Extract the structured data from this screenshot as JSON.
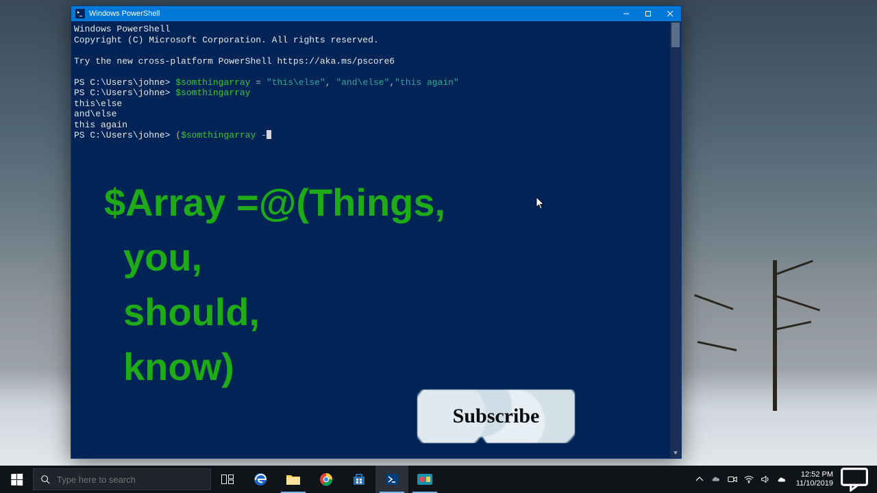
{
  "window": {
    "title": "Windows PowerShell"
  },
  "terminal": {
    "banner1": "Windows PowerShell",
    "banner2": "Copyright (C) Microsoft Corporation. All rights reserved.",
    "hint": "Try the new cross-platform PowerShell https://aka.ms/pscore6",
    "prompt": "PS C:\\Users\\johne>",
    "var_name": "$somthingarray",
    "assign_op": " = ",
    "str1": "\"this\\else\"",
    "comma": ", ",
    "str2": "\"and\\else\"",
    "comma2": ",",
    "str3": "\"this again\"",
    "out1": "this\\else",
    "out2": "and\\else",
    "out3": "this again",
    "paren_open": "(",
    "dash": " -"
  },
  "overlay": {
    "line1": "$Array =@(Things,",
    "line2": "you,",
    "line3": "should,",
    "line4": "know)"
  },
  "subscribe": {
    "label": "Subscribe"
  },
  "taskbar": {
    "search_placeholder": "Type here to search",
    "time": "12:52 PM",
    "date": "11/10/2019"
  }
}
